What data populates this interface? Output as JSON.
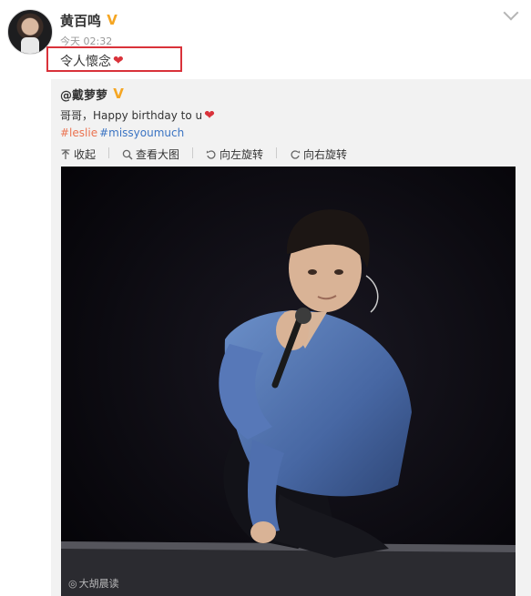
{
  "post": {
    "author": "黄百鸣",
    "timestamp": "今天 02:32",
    "text": "令人懷念"
  },
  "repost": {
    "author": "@戴萝萝",
    "text": "哥哥，Happy birthday to u",
    "tags": [
      "#leslie",
      "#missyoumuch"
    ],
    "actions": [
      {
        "icon": "collapse-icon",
        "label": "收起"
      },
      {
        "icon": "zoom-icon",
        "label": "查看大图"
      },
      {
        "icon": "rotate-left-icon",
        "label": "向左旋转"
      },
      {
        "icon": "rotate-right-icon",
        "label": "向右旋转"
      }
    ]
  },
  "watermark": {
    "text": "大胡晨读"
  },
  "colors": {
    "verified": "#f5a623",
    "heart": "#d9323a",
    "highlight_border": "#d9323a",
    "tag_orange": "#eb7350",
    "tag_blue": "#3b74c3"
  }
}
